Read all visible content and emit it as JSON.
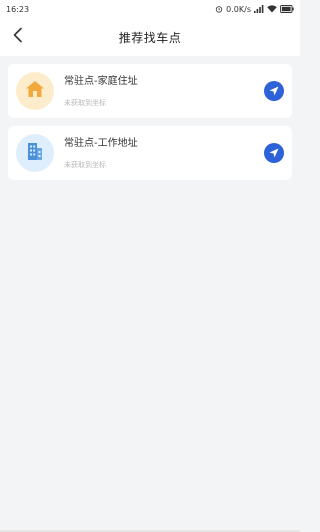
{
  "status_bar": {
    "time": "16:23",
    "network_speed": "0.0K/s",
    "icons": [
      "alarm-icon",
      "signal-icon",
      "wifi-icon",
      "battery-icon"
    ]
  },
  "header": {
    "title": "推荐找车点",
    "back_icon": "chevron-left-icon"
  },
  "locations": [
    {
      "title": "常驻点-家庭住址",
      "subtitle": "未获取到坐标",
      "icon": "home-icon",
      "icon_bg": "#fdeccc",
      "action_icon": "navigate-icon"
    },
    {
      "title": "常驻点-工作地址",
      "subtitle": "未获取到坐标",
      "icon": "building-icon",
      "icon_bg": "#dfeefc",
      "action_icon": "navigate-icon"
    }
  ],
  "colors": {
    "accent": "#2d62d8",
    "background": "#f3f4f6",
    "home_icon": "#f2a93b",
    "work_icon": "#4a8fd8"
  }
}
